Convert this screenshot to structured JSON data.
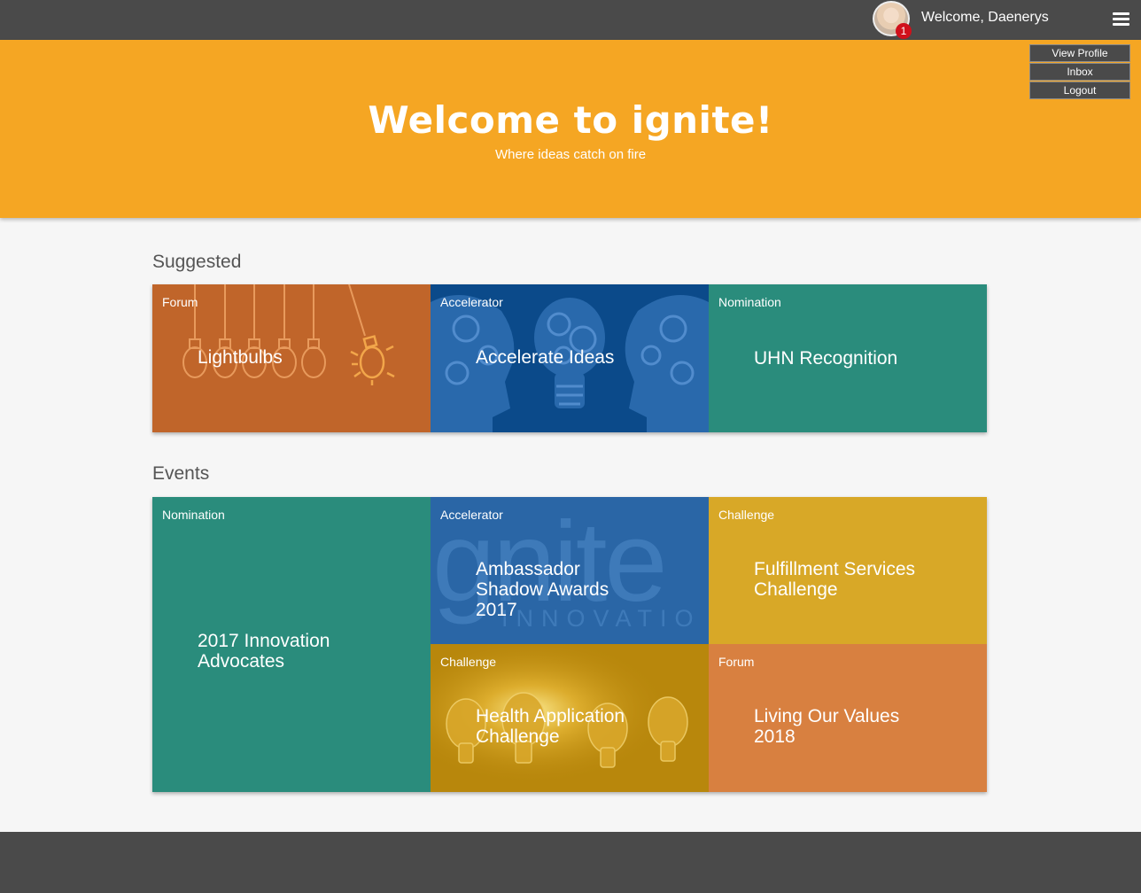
{
  "header": {
    "welcome_text": "Welcome, Daenerys",
    "notification_count": "1",
    "menu": [
      "View Profile",
      "Inbox",
      "Logout"
    ]
  },
  "hero": {
    "title": "Welcome to ignite!",
    "subtitle": "Where ideas catch on fire"
  },
  "colors": {
    "hero": "#f5a623",
    "topbar": "#4a4a4a",
    "teal": "#2a8c7c",
    "orange": "#c0652a",
    "blue": "#0b4a8a",
    "gold": "#d8a827"
  },
  "suggested": {
    "title": "Suggested",
    "tiles": [
      {
        "tag": "Forum",
        "title": "Lightbulbs"
      },
      {
        "tag": "Accelerator",
        "title": "Accelerate Ideas"
      },
      {
        "tag": "Nomination",
        "title": "UHN Recognition"
      }
    ]
  },
  "events": {
    "title": "Events",
    "tiles": [
      {
        "tag": "Nomination",
        "title_lines": [
          "2017 Innovation",
          "Advocates"
        ]
      },
      {
        "tag": "Accelerator",
        "title_lines": [
          "Ambassador",
          "Shadow Awards",
          "2017"
        ],
        "watermark": "gnite",
        "watermark_sub": "INNOVATIO"
      },
      {
        "tag": "Challenge",
        "title_lines": [
          "Fulfillment Services",
          "Challenge"
        ]
      },
      {
        "tag": "Challenge",
        "title_lines": [
          "Health Application",
          "Challenge"
        ]
      },
      {
        "tag": "Forum",
        "title_lines": [
          "Living Our Values",
          "2018"
        ]
      }
    ]
  }
}
